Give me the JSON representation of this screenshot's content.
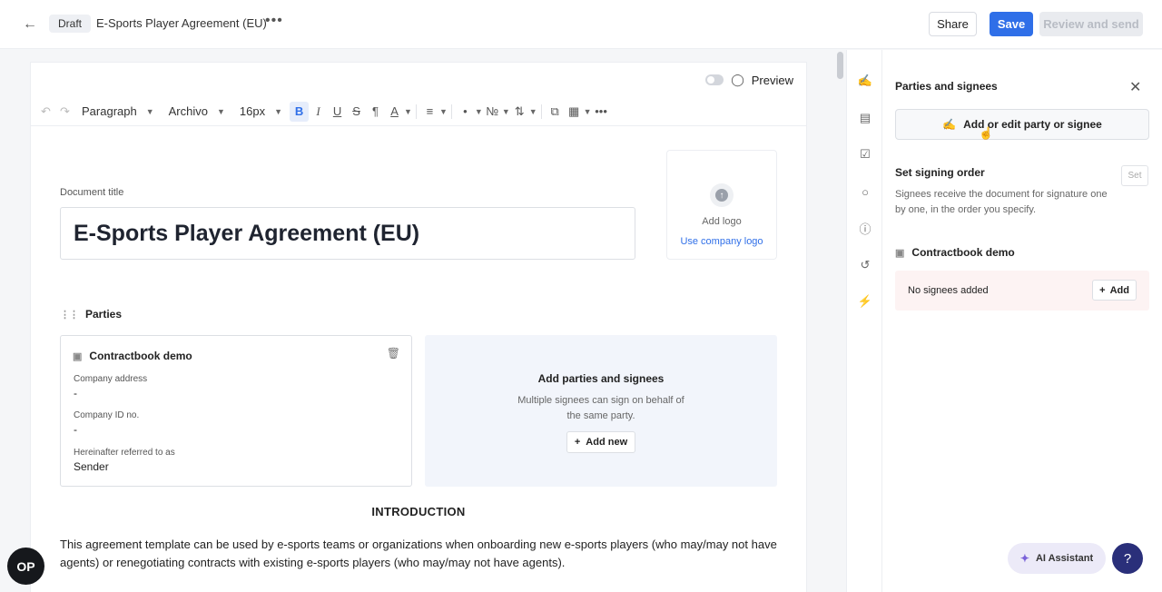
{
  "header": {
    "back_icon": "arrow-left-icon",
    "status": "Draft",
    "doc_name": "E-Sports Player Agreement (EU)",
    "more_icon": "more-horizontal-icon",
    "share_label": "Share",
    "save_label": "Save",
    "review_label": "Review and send"
  },
  "editor": {
    "preview_label": "Preview",
    "preview_enabled": false,
    "toolbar": {
      "block_style": "Paragraph",
      "font": "Archivo",
      "font_size": "16px"
    },
    "doc_title_label": "Document title",
    "doc_title": "E-Sports Player Agreement (EU)",
    "logo": {
      "add_label": "Add logo",
      "use_company_label": "Use company logo"
    },
    "parties_heading": "Parties",
    "party_card": {
      "name": "Contractbook demo",
      "fields": [
        {
          "label": "Company address",
          "value": "-"
        },
        {
          "label": "Company ID no.",
          "value": "-"
        },
        {
          "label": "Hereinafter referred to as",
          "value": "Sender"
        }
      ]
    },
    "add_parties": {
      "title": "Add parties and signees",
      "description": "Multiple signees can sign on behalf of the same party.",
      "add_new_label": "Add new"
    },
    "intro_heading": "INTRODUCTION",
    "intro_text": "This agreement template can be used by e-sports teams or organizations when onboarding new e-sports players (who may/may not have agents) or renegotiating contracts with existing e-sports players (who may/may not have agents)."
  },
  "panel": {
    "title": "Parties and signees",
    "add_edit_label": "Add or edit party or signee",
    "signing_order_title": "Set signing order",
    "set_label": "Set",
    "signing_order_desc": "Signees receive the document for signature one by one, in the order you specify.",
    "party_name": "Contractbook demo",
    "no_signees_text": "No signees added",
    "add_label": "Add"
  },
  "assistant": {
    "ai_label": "AI Assistant",
    "help_label": "?",
    "open_label": "OP"
  },
  "colors": {
    "accent": "#2f6fe8",
    "help": "#2a2f7a",
    "no_signees_bg": "#fdf3f3"
  }
}
